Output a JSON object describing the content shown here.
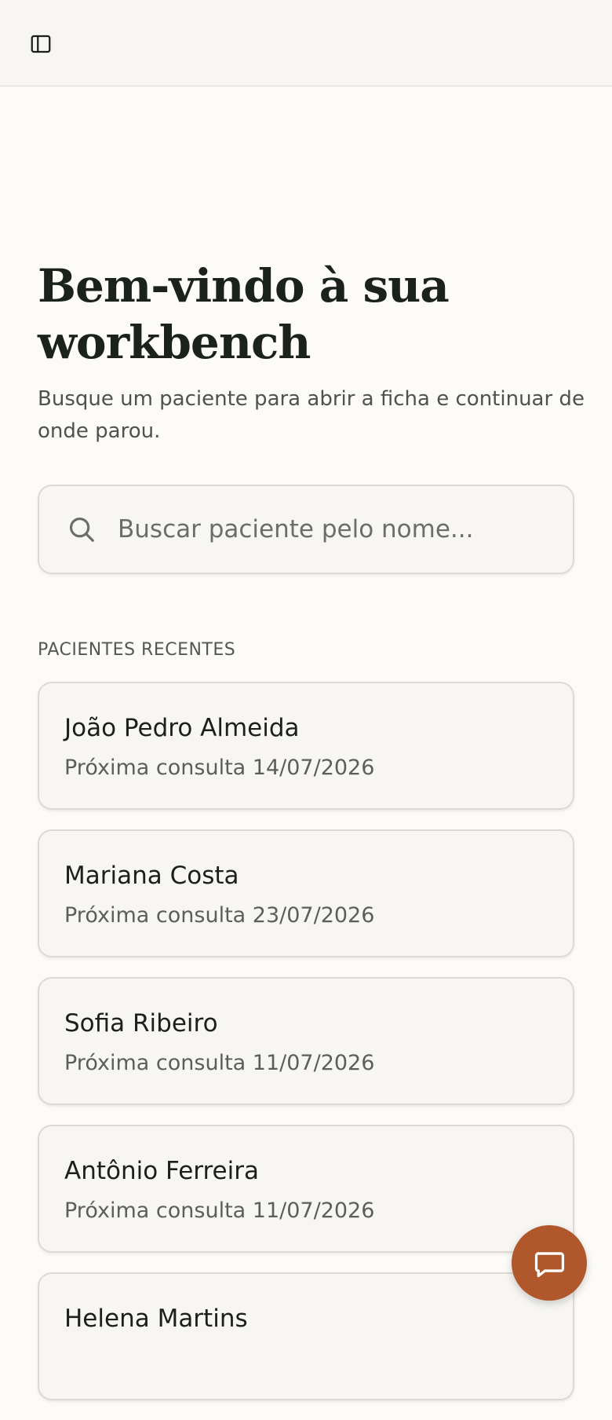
{
  "topbar": {
    "toggle_icon": "sidebar-toggle-icon"
  },
  "hero": {
    "title": "Bem-vindo à sua workbench",
    "subtitle": "Busque um paciente para abrir a ficha e continuar de onde parou."
  },
  "search": {
    "icon": "search-icon",
    "placeholder": "Buscar paciente pelo nome...",
    "value": ""
  },
  "recent": {
    "section_label": "PACIENTES RECENTES",
    "patients": [
      {
        "name": "João Pedro Almeida",
        "next": "Próxima consulta 14/07/2026"
      },
      {
        "name": "Mariana Costa",
        "next": "Próxima consulta 23/07/2026"
      },
      {
        "name": "Sofia Ribeiro",
        "next": "Próxima consulta 11/07/2026"
      },
      {
        "name": "Antônio Ferreira",
        "next": "Próxima consulta 11/07/2026"
      },
      {
        "name": "Helena Martins",
        "next": ""
      }
    ]
  },
  "chat": {
    "icon": "chat-bubble-icon"
  },
  "colors": {
    "accent": "#b0582c",
    "background": "#fcfbf8",
    "card": "#f7f6f3"
  }
}
